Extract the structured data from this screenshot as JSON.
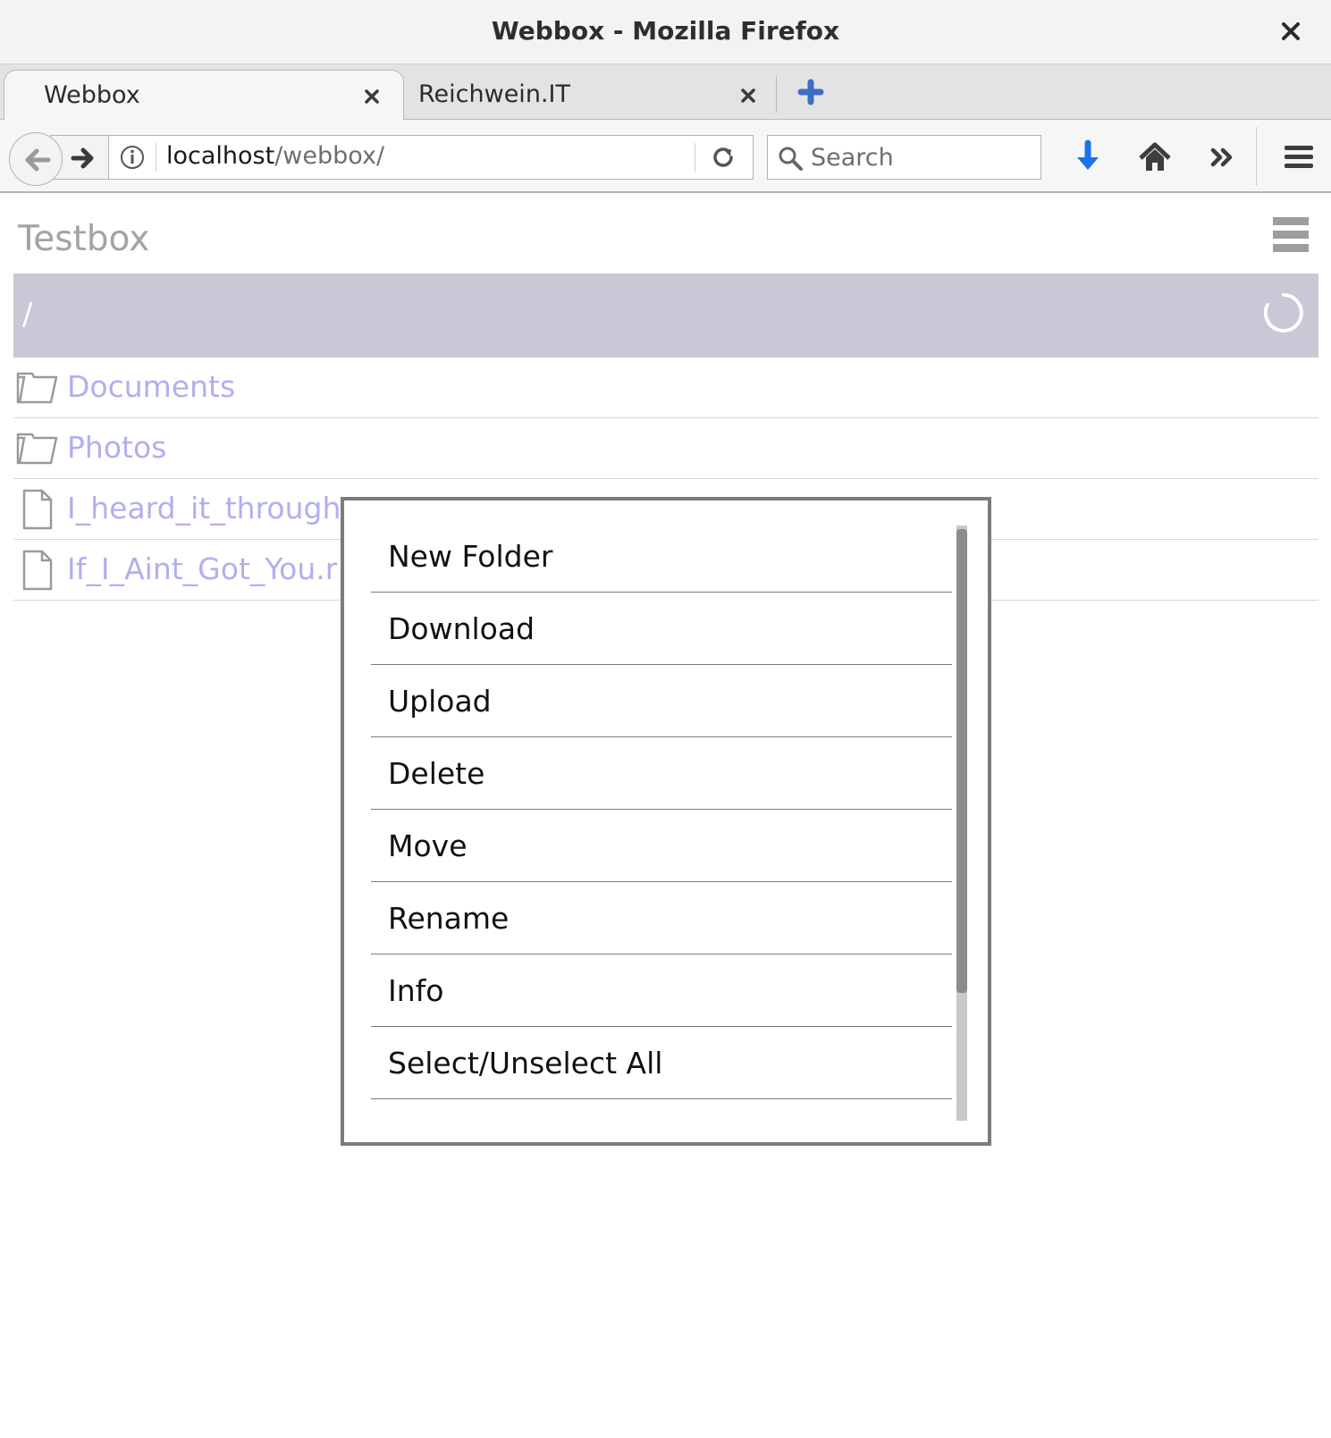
{
  "window": {
    "title": "Webbox - Mozilla Firefox"
  },
  "tabs": [
    {
      "label": "Webbox",
      "active": true
    },
    {
      "label": "Reichwein.IT",
      "active": false
    }
  ],
  "navbar": {
    "url_host": "localhost",
    "url_path": "/webbox/",
    "search_placeholder": "Search"
  },
  "app": {
    "title": "Testbox",
    "current_path": "/"
  },
  "files": [
    {
      "name": "Documents",
      "type": "folder"
    },
    {
      "name": "Photos",
      "type": "folder"
    },
    {
      "name": "I_heard_it_through",
      "type": "file"
    },
    {
      "name": "If_I_Aint_Got_You.r",
      "type": "file"
    }
  ],
  "menu": {
    "items": [
      {
        "label": "New Folder"
      },
      {
        "label": "Download"
      },
      {
        "label": "Upload"
      },
      {
        "label": "Delete"
      },
      {
        "label": "Move"
      },
      {
        "label": "Rename"
      },
      {
        "label": "Info"
      },
      {
        "label": "Select/Unselect All"
      }
    ],
    "scroll_fraction_visible": 0.78
  },
  "colors": {
    "accent_path_bar": "#c8c8d6",
    "link": "#b0b0ee",
    "download_icon": "#1a73e8",
    "newtab_icon": "#3b6fc4"
  }
}
